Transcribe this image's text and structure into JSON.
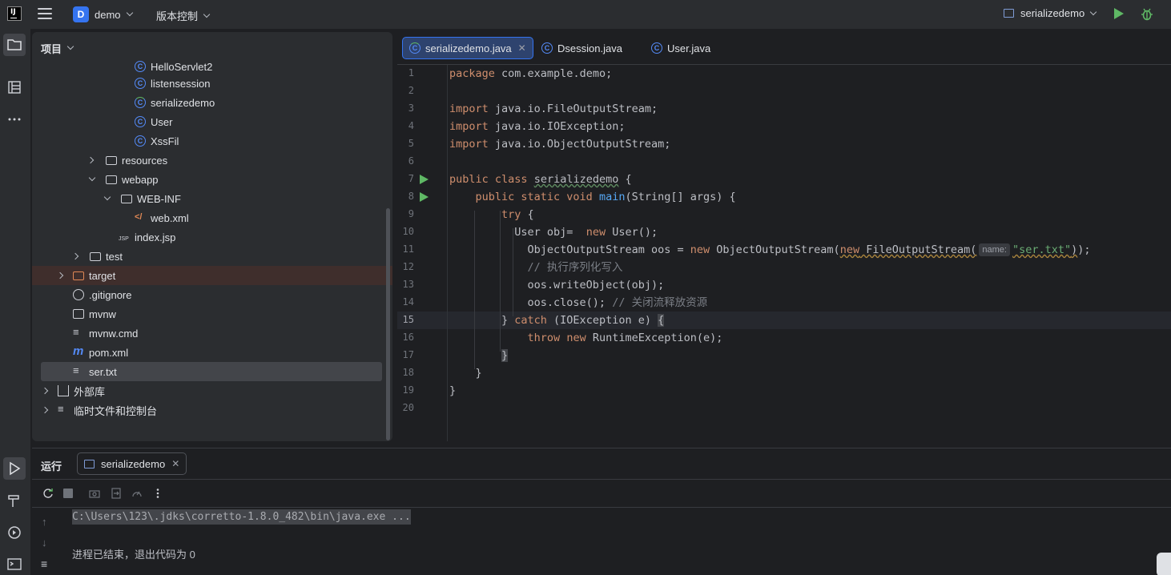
{
  "titlebar": {
    "logo_letter": "IJ",
    "project_badge": "D",
    "project_name": "demo",
    "vcs_label": "版本控制",
    "run_config": "serializedemo"
  },
  "project_panel": {
    "title": "项目",
    "items": [
      {
        "label": "HelloServlet2",
        "type": "class"
      },
      {
        "label": "listensession",
        "type": "class"
      },
      {
        "label": "serializedemo",
        "type": "class-run"
      },
      {
        "label": "User",
        "type": "class"
      },
      {
        "label": "XssFil",
        "type": "class"
      },
      {
        "label": "resources",
        "type": "folder"
      },
      {
        "label": "webapp",
        "type": "folder"
      },
      {
        "label": "WEB-INF",
        "type": "folder"
      },
      {
        "label": "web.xml",
        "type": "xml"
      },
      {
        "label": "index.jsp",
        "type": "jsp"
      },
      {
        "label": "test",
        "type": "folder"
      },
      {
        "label": "target",
        "type": "folder"
      },
      {
        "label": ".gitignore",
        "type": "ignore"
      },
      {
        "label": "mvnw",
        "type": "script"
      },
      {
        "label": "mvnw.cmd",
        "type": "text"
      },
      {
        "label": "pom.xml",
        "type": "maven"
      },
      {
        "label": "ser.txt",
        "type": "text"
      },
      {
        "label": "外部库",
        "type": "library"
      },
      {
        "label": "临时文件和控制台",
        "type": "scratch"
      }
    ]
  },
  "editor": {
    "tabs": [
      {
        "label": "serializedemo.java",
        "active": true
      },
      {
        "label": "Dsession.java",
        "active": false
      },
      {
        "label": "User.java",
        "active": false
      }
    ],
    "line_numbers": [
      "1",
      "2",
      "3",
      "4",
      "5",
      "6",
      "7",
      "8",
      "9",
      "10",
      "11",
      "12",
      "13",
      "14",
      "15",
      "16",
      "17",
      "18",
      "19",
      "20"
    ],
    "current_line": "15",
    "param_hint": "name:"
  },
  "run_panel": {
    "title": "运行",
    "tab_label": "serializedemo",
    "command": "C:\\Users\\123\\.jdks\\corretto-1.8.0_482\\bin\\java.exe ...",
    "exit_message": "进程已结束，退出代码为 0"
  }
}
